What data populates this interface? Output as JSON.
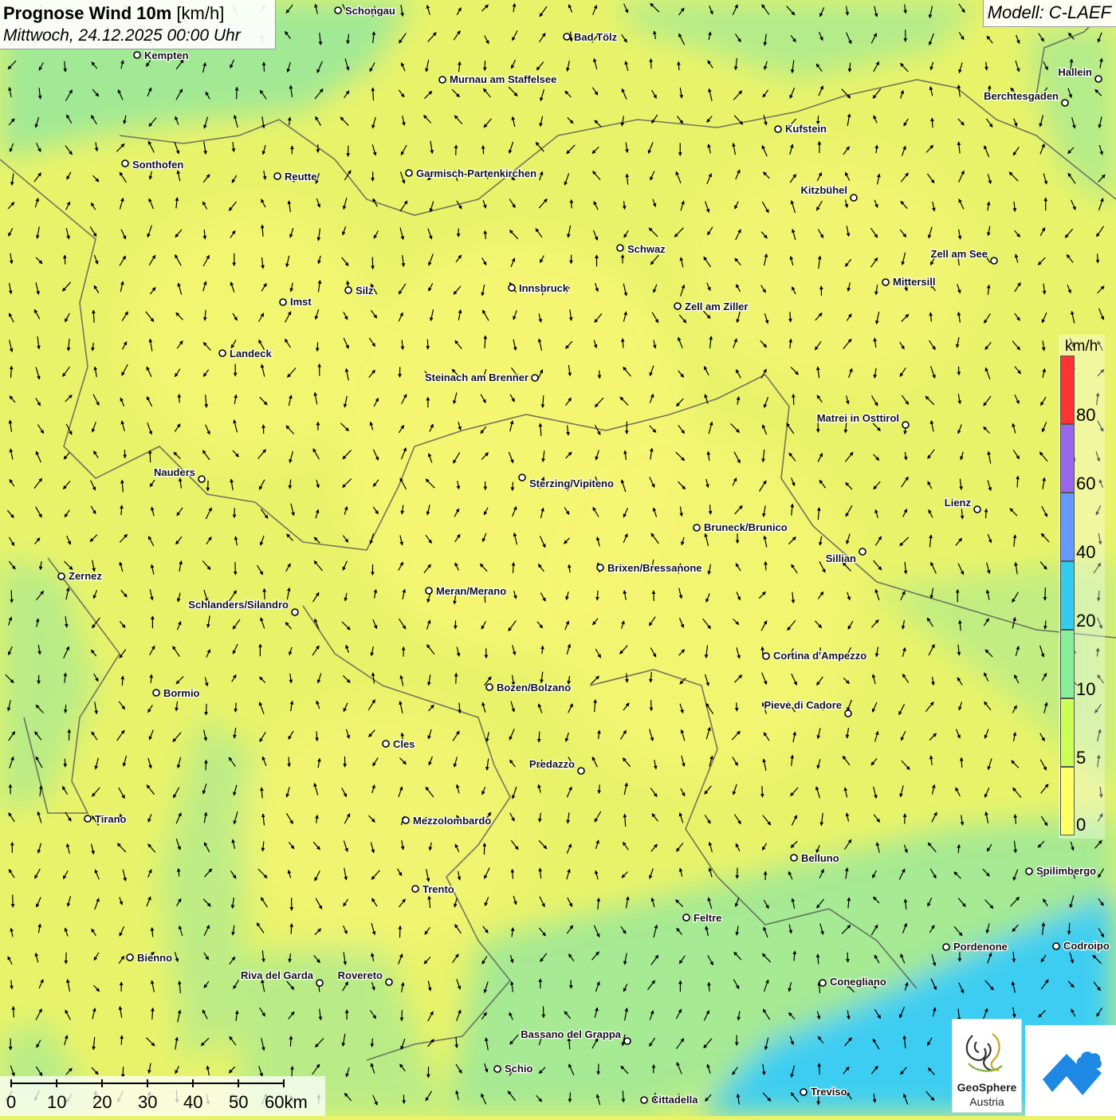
{
  "header": {
    "title_bold": "Prognose Wind 10m",
    "title_unit": "[km/h]",
    "subtitle": "Mittwoch, 24.12.2025 00:00 Uhr",
    "model": "Modell: C-LAEF"
  },
  "legend": {
    "unit": "km/h",
    "labels": [
      "0",
      "5",
      "10",
      "20",
      "40",
      "60",
      "80"
    ],
    "colors": [
      "#ffff66",
      "#ccff55",
      "#88ee99",
      "#33ccee",
      "#6699ff",
      "#9966ee",
      "#ff3333"
    ]
  },
  "scale": {
    "labels": [
      "0",
      "10",
      "20",
      "30",
      "40",
      "50",
      "60km"
    ]
  },
  "logos": {
    "geosphere_line1": "GeoSphere",
    "geosphere_line2": "Austria"
  },
  "map": {
    "colors": {
      "base": "#e9f36a",
      "yellow": "#f8f675",
      "green": "#9ae89a",
      "blue": "#3ccdf2",
      "arrow": "#000000",
      "border": "#555555",
      "city_border": "#9a7a3a"
    },
    "cities": [
      {
        "name": "Schongau"
      },
      {
        "name": "Bad Tölz"
      },
      {
        "name": "Kempten"
      },
      {
        "name": "Murnau am Staffelsee"
      },
      {
        "name": "Hallein"
      },
      {
        "name": "Berchtesgaden"
      },
      {
        "name": "Kufstein"
      },
      {
        "name": "Sonthofen"
      },
      {
        "name": "Reutte"
      },
      {
        "name": "Garmisch-Partenkirchen"
      },
      {
        "name": "Kitzbühel"
      },
      {
        "name": "Schwaz"
      },
      {
        "name": "Zell am See"
      },
      {
        "name": "Mittersill"
      },
      {
        "name": "Innsbruck"
      },
      {
        "name": "Silz"
      },
      {
        "name": "Imst"
      },
      {
        "name": "Zell am Ziller"
      },
      {
        "name": "Landeck"
      },
      {
        "name": "Steinach am Brenner"
      },
      {
        "name": "Matrei in Osttirol"
      },
      {
        "name": "Nauders"
      },
      {
        "name": "Sterzing/Vipiteno"
      },
      {
        "name": "Lienz"
      },
      {
        "name": "Bruneck/Brunico"
      },
      {
        "name": "Sillian"
      },
      {
        "name": "Brixen/Bressanone"
      },
      {
        "name": "Zernez"
      },
      {
        "name": "Meran/Merano"
      },
      {
        "name": "Schlanders/Silandro"
      },
      {
        "name": "Cortina d'Ampezzo"
      },
      {
        "name": "Bozen/Bolzano"
      },
      {
        "name": "Bormio"
      },
      {
        "name": "Pieve di Cadore"
      },
      {
        "name": "Cles"
      },
      {
        "name": "Predazzo"
      },
      {
        "name": "Tirano"
      },
      {
        "name": "Mezzolombardo"
      },
      {
        "name": "Belluno"
      },
      {
        "name": "Spilimbergo"
      },
      {
        "name": "Trento"
      },
      {
        "name": "Feltre"
      },
      {
        "name": "Pordenone"
      },
      {
        "name": "Codroipo"
      },
      {
        "name": "Bienno"
      },
      {
        "name": "Riva del Garda"
      },
      {
        "name": "Rovereto"
      },
      {
        "name": "Conegliano"
      },
      {
        "name": "Bassano del Grappa"
      },
      {
        "name": "Schio"
      },
      {
        "name": "Treviso"
      },
      {
        "name": "Cittadella"
      }
    ]
  }
}
